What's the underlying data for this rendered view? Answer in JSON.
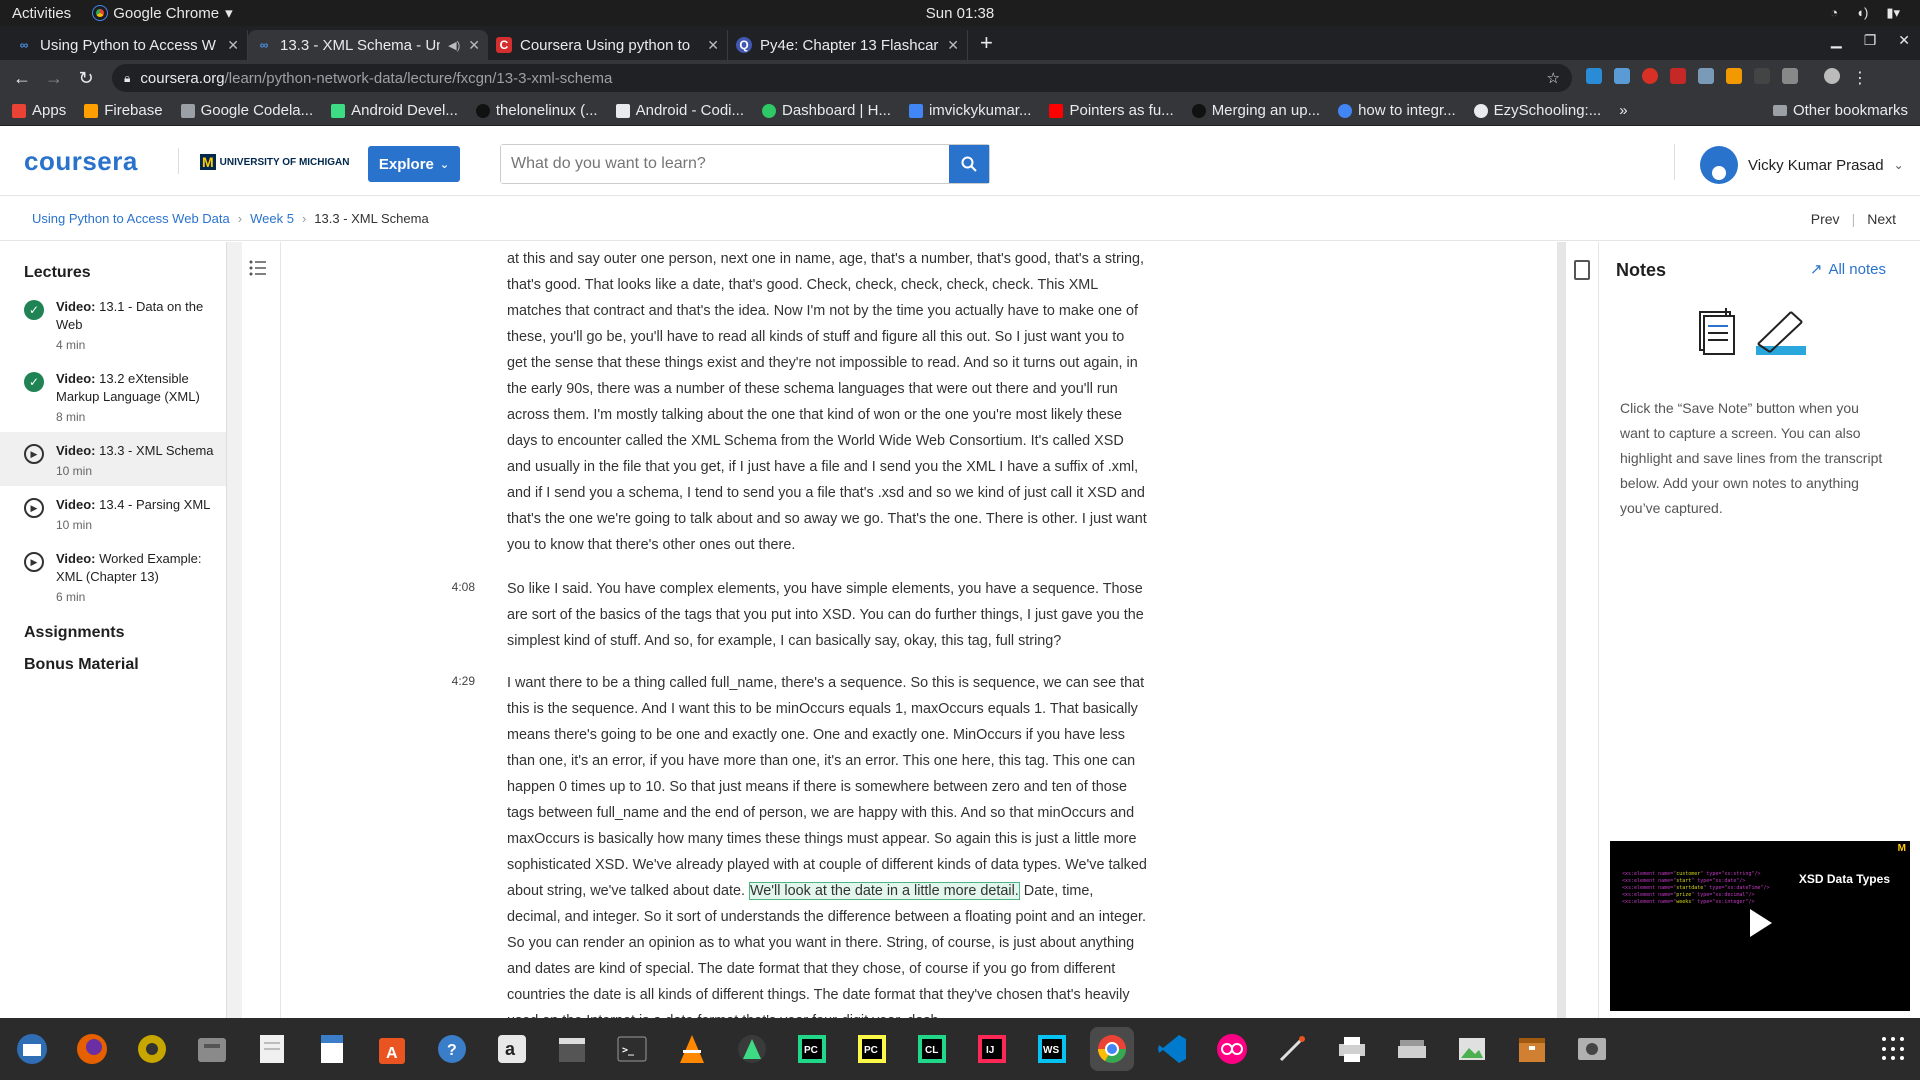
{
  "system": {
    "activities": "Activities",
    "app_name": "Google Chrome",
    "clock": "Sun 01:38"
  },
  "tabs": [
    {
      "title": "Using Python to Access W",
      "icon": "coursera-infinity-icon",
      "color": "#4a90e2"
    },
    {
      "title": "13.3 - XML Schema - Un",
      "icon": "coursera-infinity-icon",
      "color": "#4a90e2",
      "active": true
    },
    {
      "title": "Coursera Using python to",
      "icon": "coursera-c-icon",
      "color": "#d32f2f"
    },
    {
      "title": "Py4e: Chapter 13 Flashcar",
      "icon": "quizlet-q-icon",
      "color": "#4257b2"
    }
  ],
  "address_bar": {
    "host": "coursera.org",
    "path": "/learn/python-network-data/lecture/fxcgn/13-3-xml-schema"
  },
  "bookmarks": [
    {
      "label": "Apps",
      "color": "#ea4335"
    },
    {
      "label": "Firebase",
      "color": "#ffa000"
    },
    {
      "label": "Google Codela...",
      "color": "#9aa0a6"
    },
    {
      "label": "Android Devel...",
      "color": "#3ddc84"
    },
    {
      "label": "thelonelinux (...",
      "color": "#111111"
    },
    {
      "label": "Android - Codi...",
      "color": "#e8eaed"
    },
    {
      "label": "Dashboard | H...",
      "color": "#2ec866"
    },
    {
      "label": "imvickykumar...",
      "color": "#4285f4"
    },
    {
      "label": "Pointers as fu...",
      "color": "#ff0000"
    },
    {
      "label": "Merging an up...",
      "color": "#111111"
    },
    {
      "label": "how to integr...",
      "color": "#4285f4"
    },
    {
      "label": "EzySchooling:...",
      "color": "#e8eaed"
    }
  ],
  "bookmarks_more": "»",
  "bookmarks_other": "Other bookmarks",
  "coursera": {
    "logo": "coursera",
    "partner": "UNIVERSITY OF MICHIGAN",
    "partner_mark": "M",
    "explore": "Explore",
    "search_placeholder": "What do you want to learn?",
    "user_name": "Vicky Kumar Prasad"
  },
  "breadcrumb": {
    "course": "Using Python to Access Web Data",
    "week": "Week 5",
    "current": "13.3 - XML Schema",
    "prev": "Prev",
    "next": "Next"
  },
  "sidebar": {
    "lectures_heading": "Lectures",
    "lectures": [
      {
        "kind": "Video:",
        "title": "13.1 - Data on the Web",
        "duration": "4 min",
        "status": "done"
      },
      {
        "kind": "Video:",
        "title": "13.2 eXtensible Markup Language (XML)",
        "duration": "8 min",
        "status": "done"
      },
      {
        "kind": "Video:",
        "title": "13.3 - XML Schema",
        "duration": "10 min",
        "status": "active"
      },
      {
        "kind": "Video:",
        "title": "13.4 - Parsing XML",
        "duration": "10 min",
        "status": "todo"
      },
      {
        "kind": "Video:",
        "title": "Worked Example: XML (Chapter 13)",
        "duration": "6 min",
        "status": "todo"
      }
    ],
    "assignments": "Assignments",
    "bonus": "Bonus Material"
  },
  "transcript": {
    "p1": "at this and say outer one person, next one in name, age, that's a number, that's good, that's a string, that's good. That looks like a date, that's good. Check, check, check, check, check. This XML matches that contract and that's the idea. Now I'm not by the time you actually have to make one of these, you'll go be, you'll have to read all kinds of stuff and figure all this out. So I just want you to get the sense that these things exist and they're not impossible to read. And so it turns out again, in the early 90s, there was a number of these schema languages that were out there and you'll run across them. I'm mostly talking about the one that kind of won or the one you're most likely these days to encounter called the XML Schema from the World Wide Web Consortium. It's called XSD and usually in the file that you get, if I just have a file and I send you the XML I have a suffix of .xml, and if I send you a schema, I tend to send you a file that's .xsd and so we kind of just call it XSD and that's the one we're going to talk about and so away we go. That's the one. There is other. I just want you to know that there's other ones out there.",
    "ts2": "4:08",
    "p2": "So like I said. You have complex elements, you have simple elements, you have a sequence. Those are sort of the basics of the tags that you put into XSD. You can do further things, I just gave you the simplest kind of stuff. And so, for example, I can basically say, okay, this tag, full string?",
    "ts3": "4:29",
    "p3a": "I want there to be a thing called full_name, there's a sequence. So this is sequence, we can see that this is the sequence. And I want this to be minOccurs equals 1, maxOccurs equals 1. That basically means there's going to be one and exactly one. One and exactly one. MinOccurs if you have less than one, it's an error, if you have more than one, it's an error. This one here, this tag. This one can happen 0 times up to 10. So that just means if there is somewhere between zero and ten of those tags between full_name and the end of person, we are happy with this. And so that minOccurs and maxOccurs is basically how many times these things must appear. So again this is just a little more sophisticated XSD. We've already played with at couple of different kinds of data types. We've talked about string, we've talked about date. ",
    "p3_highlight": "We'll look at the date in a little more detail.",
    "p3b": " Date, time, decimal, and integer. So it sort of understands the difference between a floating point and an integer. So you can render an opinion as to what you want in there. String, of course, is just about anything and dates are kind of special. The date format that they chose, of course if you go from different countries the date is all kinds of different things. The date format that they've chosen that's heavily used on the Internet is a date format that's year four-digit year, dash"
  },
  "notes": {
    "title": "Notes",
    "all_notes": "All notes",
    "hint": "Click the “Save Note” button when you want to capture a screen. You can also highlight and save lines from the transcript below. Add your own notes to anything you’ve captured."
  },
  "video_thumb": {
    "title": "XSD Data Types"
  },
  "dock": [
    {
      "name": "thunderbird-icon",
      "color": "#2f6db5"
    },
    {
      "name": "firefox-icon",
      "color": "#e66000"
    },
    {
      "name": "rhythmbox-icon",
      "color": "#c8a600"
    },
    {
      "name": "files-icon",
      "color": "#8a8a8a"
    },
    {
      "name": "text-editor-icon",
      "color": "#f0f0f0"
    },
    {
      "name": "writer-icon",
      "color": "#3a7dc9"
    },
    {
      "name": "software-center-icon",
      "color": "#e95420"
    },
    {
      "name": "help-icon",
      "color": "#3a7dc9"
    },
    {
      "name": "amazon-icon",
      "color": "#e8e8e8"
    },
    {
      "name": "video-clapper-icon",
      "color": "#555555"
    },
    {
      "name": "terminal-icon",
      "color": "#2e2e2e"
    },
    {
      "name": "vlc-icon",
      "color": "#ff8800"
    },
    {
      "name": "android-studio-icon",
      "color": "#3ddc84"
    },
    {
      "name": "pycharm-ce-icon",
      "color": "#21d789"
    },
    {
      "name": "pycharm-pro-icon",
      "color": "#21d789"
    },
    {
      "name": "clion-icon",
      "color": "#21d789"
    },
    {
      "name": "intellij-icon",
      "color": "#000000"
    },
    {
      "name": "webstorm-icon",
      "color": "#07c3f2"
    },
    {
      "name": "chrome-icon",
      "color": "#4285f4"
    },
    {
      "name": "vscode-icon",
      "color": "#007acc"
    },
    {
      "name": "flickr-icon",
      "color": "#ff0084"
    },
    {
      "name": "pen-tool-icon",
      "color": "#e0e0e0"
    },
    {
      "name": "printer-icon",
      "color": "#d0d0d0"
    },
    {
      "name": "scanner-icon",
      "color": "#d0d0d0"
    },
    {
      "name": "image-viewer-icon",
      "color": "#e0e0e0"
    },
    {
      "name": "archive-icon",
      "color": "#d08030"
    },
    {
      "name": "screenshot-icon",
      "color": "#b0b0b0"
    }
  ]
}
